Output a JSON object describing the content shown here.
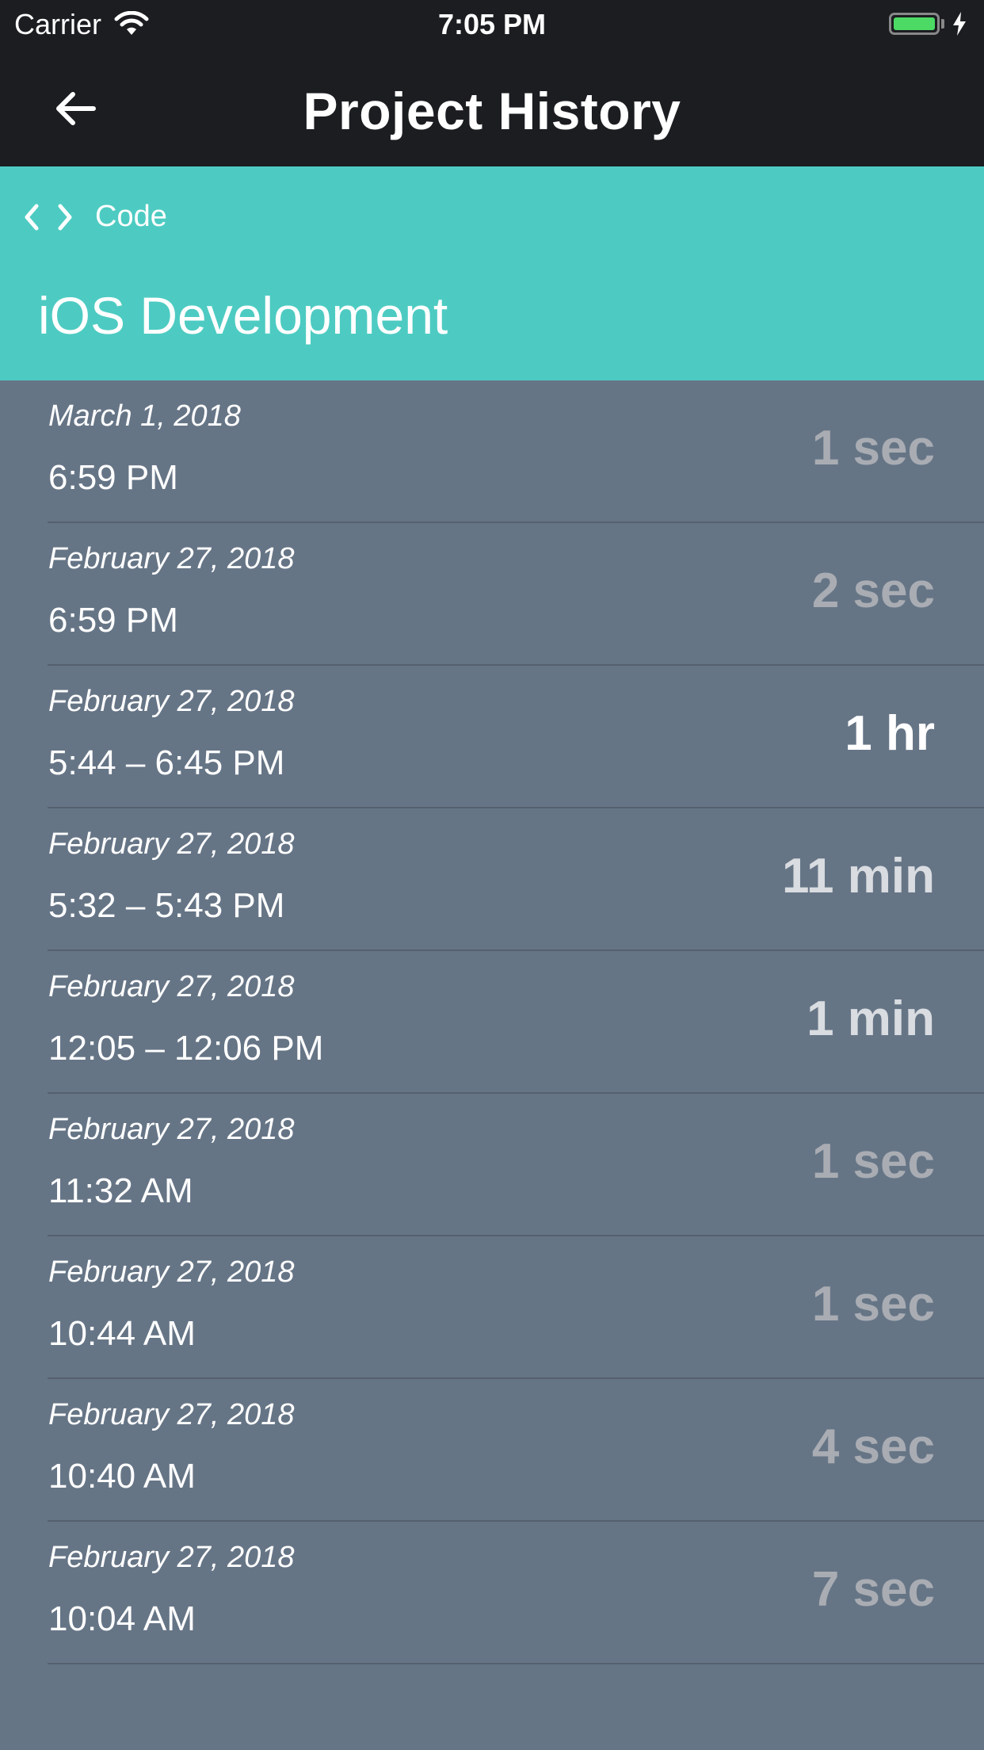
{
  "status_bar": {
    "carrier": "Carrier",
    "time": "7:05 PM",
    "battery_color": "#4cd964"
  },
  "nav": {
    "title": "Project History",
    "back_icon": "arrow-left-icon"
  },
  "project": {
    "category_icon": "code-icon",
    "category": "Code",
    "name": "iOS Development",
    "header_color": "#4dcbc2"
  },
  "colors": {
    "list_background": "#667586",
    "duration_short": "#a9adb3",
    "duration_medium": "#d9dce0",
    "duration_long": "#ffffff"
  },
  "sessions": [
    {
      "date": "March 1, 2018",
      "time": "6:59 PM",
      "duration": "1 sec",
      "emphasis": "short"
    },
    {
      "date": "February 27, 2018",
      "time": "6:59 PM",
      "duration": "2 sec",
      "emphasis": "short"
    },
    {
      "date": "February 27, 2018",
      "time": "5:44 – 6:45 PM",
      "duration": "1 hr",
      "emphasis": "long"
    },
    {
      "date": "February 27, 2018",
      "time": "5:32 – 5:43 PM",
      "duration": "11 min",
      "emphasis": "medium"
    },
    {
      "date": "February 27, 2018",
      "time": "12:05 – 12:06 PM",
      "duration": "1 min",
      "emphasis": "medium"
    },
    {
      "date": "February 27, 2018",
      "time": "11:32 AM",
      "duration": "1 sec",
      "emphasis": "short"
    },
    {
      "date": "February 27, 2018",
      "time": "10:44 AM",
      "duration": "1 sec",
      "emphasis": "short"
    },
    {
      "date": "February 27, 2018",
      "time": "10:40 AM",
      "duration": "4 sec",
      "emphasis": "short"
    },
    {
      "date": "February 27, 2018",
      "time": "10:04 AM",
      "duration": "7 sec",
      "emphasis": "short"
    }
  ]
}
